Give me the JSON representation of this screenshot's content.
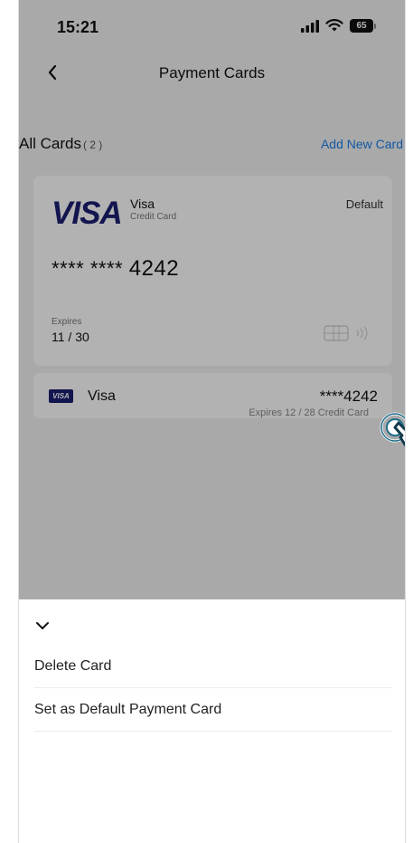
{
  "status_bar": {
    "time": "15:21",
    "battery": "65"
  },
  "nav": {
    "title": "Payment Cards"
  },
  "cards_header": {
    "label": "All Cards",
    "count": "( 2 )",
    "add_new": "Add New Card"
  },
  "default_card": {
    "logo": "VISA",
    "brand": "Visa",
    "type": "Credit Card",
    "tag": "Default",
    "masked": "**** ****",
    "last4": "4242",
    "expires_label": "Expires",
    "expires_value": "11 / 30"
  },
  "second_card": {
    "logo": "VISA",
    "brand": "Visa",
    "number": "****4242",
    "meta": "Expires 12 / 28  Credit Card"
  },
  "sheet": {
    "items": [
      {
        "label": "Delete Card"
      },
      {
        "label": "Set as Default Payment Card"
      }
    ]
  },
  "colors": {
    "accent": "#1a7ee8",
    "visa_blue": "#1a1f71",
    "overlay": "rgba(0,0,0,0.30)"
  },
  "icons": [
    "chevron-left-icon",
    "signal-icon",
    "wifi-icon",
    "battery-icon",
    "chip-icon",
    "contactless-icon",
    "chevron-down-icon",
    "tap-indicator-icon"
  ]
}
